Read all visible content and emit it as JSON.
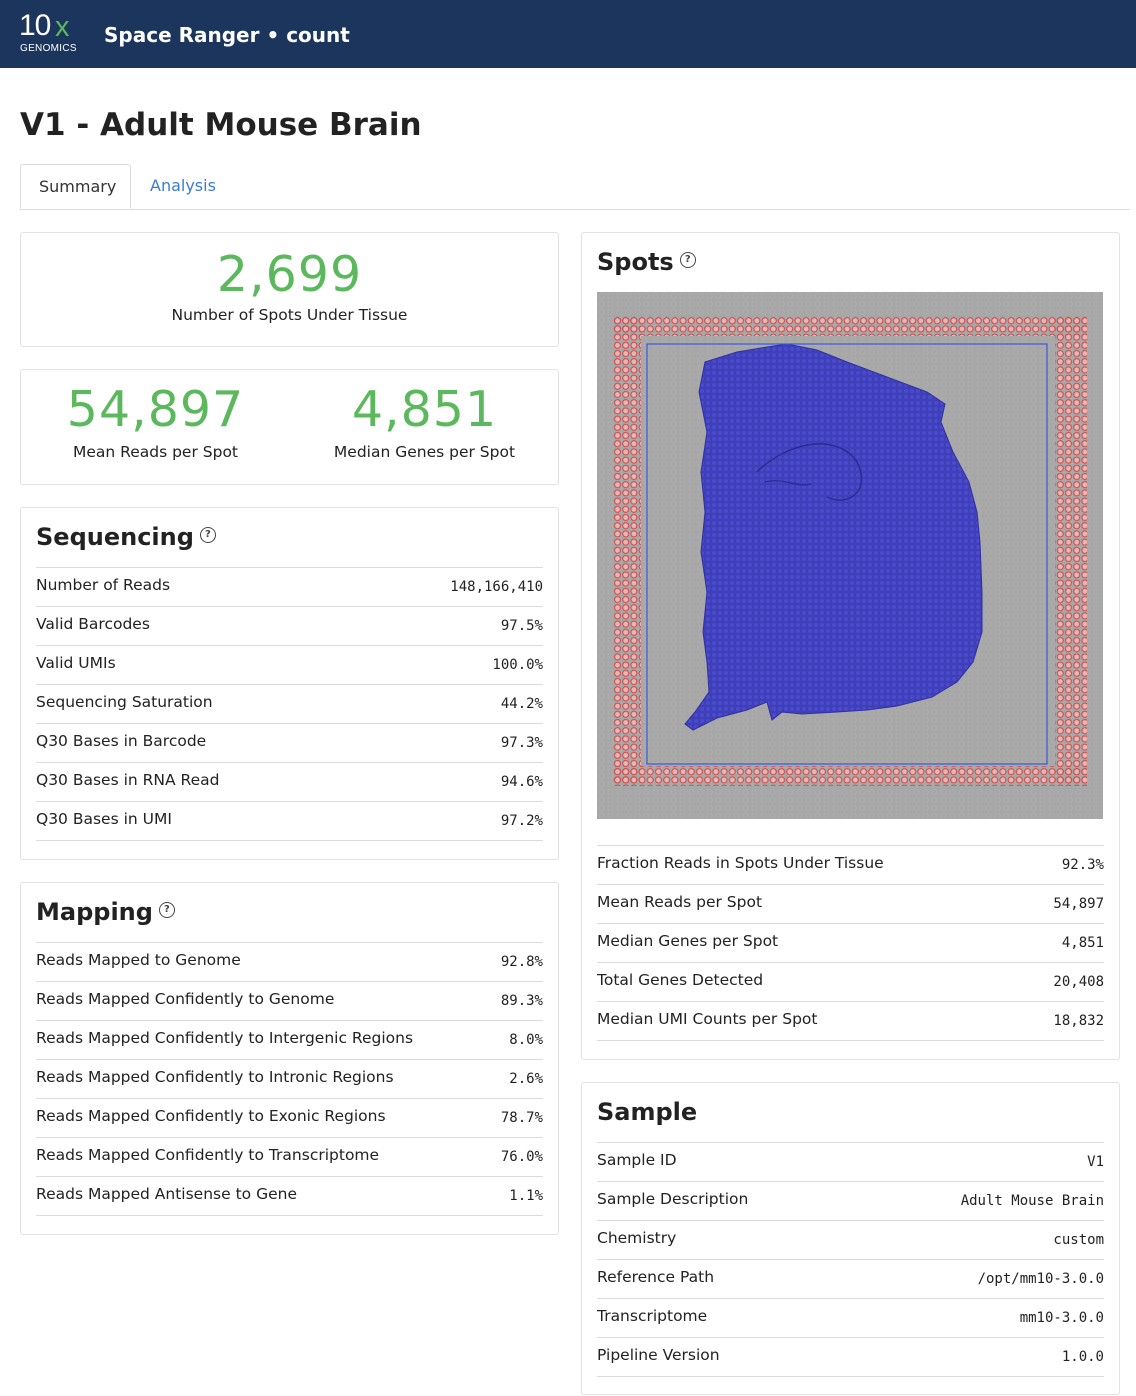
{
  "header": {
    "logo_main": "10",
    "logo_x": "x",
    "logo_sub": "GENOMICS",
    "logo_x_color": "#5cb85c",
    "title": "Space Ranger • count",
    "bg_color": "#1b355c"
  },
  "page_title": "V1 - Adult Mouse Brain",
  "tabs": [
    {
      "label": "Summary",
      "active": true
    },
    {
      "label": "Analysis",
      "active": false
    }
  ],
  "hero": {
    "spots_value": "2,699",
    "spots_label": "Number of Spots Under Tissue",
    "mean_reads_value": "54,897",
    "mean_reads_label": "Mean Reads per Spot",
    "median_genes_value": "4,851",
    "median_genes_label": "Median Genes per Spot",
    "value_color": "#5cb85c"
  },
  "sequencing": {
    "title": "Sequencing",
    "help_icon": "question-circle-icon",
    "rows": [
      {
        "label": "Number of Reads",
        "value": "148,166,410"
      },
      {
        "label": "Valid Barcodes",
        "value": "97.5%"
      },
      {
        "label": "Valid UMIs",
        "value": "100.0%"
      },
      {
        "label": "Sequencing Saturation",
        "value": "44.2%"
      },
      {
        "label": "Q30 Bases in Barcode",
        "value": "97.3%"
      },
      {
        "label": "Q30 Bases in RNA Read",
        "value": "94.6%"
      },
      {
        "label": "Q30 Bases in UMI",
        "value": "97.2%"
      }
    ]
  },
  "mapping": {
    "title": "Mapping",
    "help_icon": "question-circle-icon",
    "rows": [
      {
        "label": "Reads Mapped to Genome",
        "value": "92.8%"
      },
      {
        "label": "Reads Mapped Confidently to Genome",
        "value": "89.3%"
      },
      {
        "label": "Reads Mapped Confidently to Intergenic Regions",
        "value": "8.0%"
      },
      {
        "label": "Reads Mapped Confidently to Intronic Regions",
        "value": "2.6%"
      },
      {
        "label": "Reads Mapped Confidently to Exonic Regions",
        "value": "78.7%"
      },
      {
        "label": "Reads Mapped Confidently to Transcriptome",
        "value": "76.0%"
      },
      {
        "label": "Reads Mapped Antisense to Gene",
        "value": "1.1%"
      }
    ]
  },
  "spots": {
    "title": "Spots",
    "help_icon": "question-circle-icon",
    "image": "tissue-spots-image",
    "tissue_color": "#3c3cb4",
    "fiducial_color": "#d9534f",
    "rows": [
      {
        "label": "Fraction Reads in Spots Under Tissue",
        "value": "92.3%"
      },
      {
        "label": "Mean Reads per Spot",
        "value": "54,897"
      },
      {
        "label": "Median Genes per Spot",
        "value": "4,851"
      },
      {
        "label": "Total Genes Detected",
        "value": "20,408"
      },
      {
        "label": "Median UMI Counts per Spot",
        "value": "18,832"
      }
    ]
  },
  "sample": {
    "title": "Sample",
    "rows": [
      {
        "label": "Sample ID",
        "value": "V1"
      },
      {
        "label": "Sample Description",
        "value": "Adult Mouse Brain"
      },
      {
        "label": "Chemistry",
        "value": "custom"
      },
      {
        "label": "Reference Path",
        "value": "/opt/mm10-3.0.0"
      },
      {
        "label": "Transcriptome",
        "value": "mm10-3.0.0"
      },
      {
        "label": "Pipeline Version",
        "value": "1.0.0"
      }
    ]
  }
}
